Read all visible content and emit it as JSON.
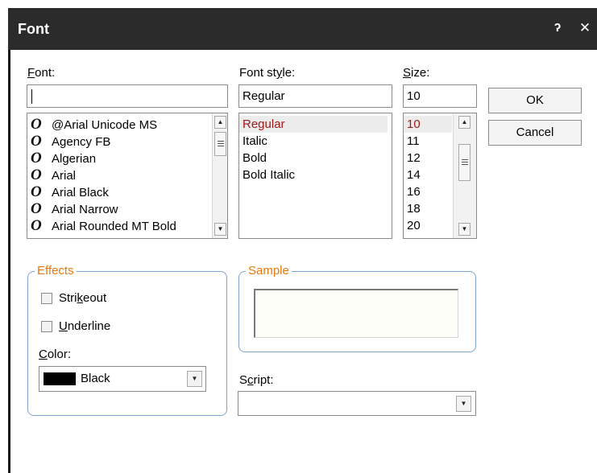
{
  "window": {
    "title": "Font",
    "help_icon": "help-icon",
    "close_icon": "close-icon"
  },
  "font": {
    "label_mnemonic": "F",
    "label_rest": "ont:",
    "value": "",
    "items": [
      "@Arial Unicode MS",
      "Agency FB",
      "Algerian",
      "Arial",
      "Arial Black",
      "Arial Narrow",
      "Arial Rounded MT Bold"
    ],
    "item_icon": "opentype-font-icon"
  },
  "style": {
    "label_pre": "Font st",
    "label_mnemonic": "y",
    "label_post": "le:",
    "value": "Regular",
    "items": [
      "Regular",
      "Italic",
      "Bold",
      "Bold Italic"
    ],
    "selected": "Regular"
  },
  "size": {
    "label_mnemonic": "S",
    "label_rest": "ize:",
    "value": "10",
    "items": [
      "10",
      "11",
      "12",
      "14",
      "16",
      "18",
      "20"
    ],
    "selected": "10"
  },
  "buttons": {
    "ok": "OK",
    "cancel": "Cancel"
  },
  "effects": {
    "title": "Effects",
    "strikeout_pre": "Stri",
    "strikeout_mnemonic": "k",
    "strikeout_post": "eout",
    "strikeout_checked": false,
    "underline_mnemonic": "U",
    "underline_rest": "nderline",
    "underline_checked": false,
    "color_mnemonic": "C",
    "color_rest": "olor:",
    "color_value": "Black",
    "color_hex": "#000000"
  },
  "sample": {
    "title": "Sample",
    "text": ""
  },
  "script": {
    "label_pre": "S",
    "label_mnemonic": "c",
    "label_post": "ript:",
    "value": ""
  },
  "colors": {
    "titlebar": "#2b2b2b",
    "group_title": "#e8780c",
    "group_border": "#7fa3cc",
    "selected_text": "#a01818"
  }
}
